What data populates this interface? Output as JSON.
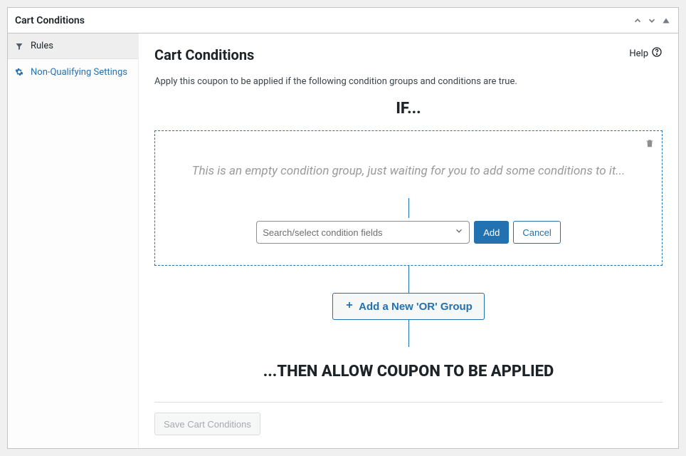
{
  "panel": {
    "title": "Cart Conditions"
  },
  "sidebar": {
    "items": [
      {
        "label": "Rules"
      },
      {
        "label": "Non-Qualifying Settings"
      }
    ]
  },
  "main": {
    "title": "Cart Conditions",
    "help_label": "Help",
    "description": "Apply this coupon to be applied if the following condition groups and conditions are true.",
    "if_heading": "IF...",
    "then_heading": "...THEN ALLOW COUPON TO BE APPLIED"
  },
  "condition_group": {
    "empty_message": "This is an empty condition group, just waiting for you to add some conditions to it...",
    "select_placeholder": "Search/select condition fields",
    "add_label": "Add",
    "cancel_label": "Cancel"
  },
  "or_group": {
    "button_label": "Add a New 'OR' Group"
  },
  "save": {
    "label": "Save Cart Conditions"
  }
}
